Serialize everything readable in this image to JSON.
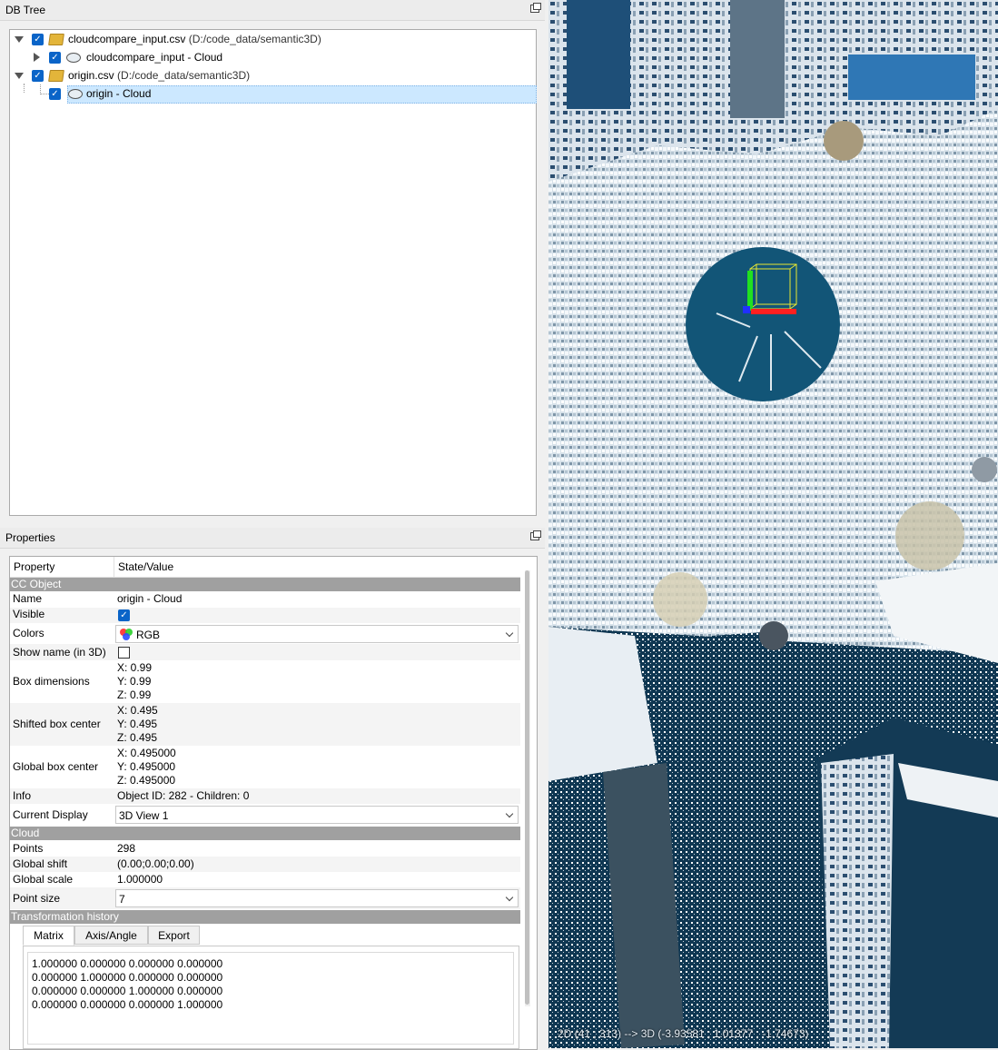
{
  "db_tree": {
    "title": "DB Tree",
    "items": [
      {
        "label": "cloudcompare_input.csv",
        "path": "(D:/code_data/semantic3D)"
      },
      {
        "label": "cloudcompare_input - Cloud"
      },
      {
        "label": "origin.csv",
        "path": "(D:/code_data/semantic3D)"
      },
      {
        "label": "origin - Cloud"
      }
    ]
  },
  "properties": {
    "title": "Properties",
    "header": {
      "property": "Property",
      "value": "State/Value"
    },
    "sections": {
      "cc_object": "CC Object",
      "cloud": "Cloud",
      "transformation": "Transformation history"
    },
    "rows": {
      "name": {
        "key": "Name",
        "value": "origin - Cloud"
      },
      "visible": {
        "key": "Visible"
      },
      "colors": {
        "key": "Colors",
        "value": "RGB"
      },
      "show_name": {
        "key": "Show name (in 3D)"
      },
      "box_dimensions": {
        "key": "Box dimensions",
        "x": "X: 0.99",
        "y": "Y: 0.99",
        "z": "Z: 0.99"
      },
      "shifted_center": {
        "key": "Shifted box center",
        "x": "X: 0.495",
        "y": "Y: 0.495",
        "z": "Z: 0.495"
      },
      "global_center": {
        "key": "Global box center",
        "x": "X: 0.495000",
        "y": "Y: 0.495000",
        "z": "Z: 0.495000"
      },
      "info": {
        "key": "Info",
        "value": "Object ID: 282 - Children: 0"
      },
      "current_display": {
        "key": "Current Display",
        "value": "3D View 1"
      },
      "points": {
        "key": "Points",
        "value": "298"
      },
      "global_shift": {
        "key": "Global shift",
        "value": "(0.00;0.00;0.00)"
      },
      "global_scale": {
        "key": "Global scale",
        "value": "1.000000"
      },
      "point_size": {
        "key": "Point size",
        "value": "7"
      }
    },
    "tabs": [
      "Matrix",
      "Axis/Angle",
      "Export"
    ],
    "matrix_text": "1.000000 0.000000 0.000000 0.000000\n0.000000 1.000000 0.000000 0.000000\n0.000000 0.000000 1.000000 0.000000\n0.000000 0.000000 0.000000 1.000000"
  },
  "view3d": {
    "status": "2D (41 ; 313) --> 3D (-3.93581 ; 1.01377 ; -1.74673)",
    "background_color": "#0f3752"
  },
  "colors": {
    "selection": "#cce8ff",
    "checkbox": "#0a64c8",
    "section_header": "#a0a0a0",
    "axis_x": "#ff2020",
    "axis_y": "#20e020",
    "axis_z": "#2030ff",
    "bbox": "#e8e830"
  }
}
